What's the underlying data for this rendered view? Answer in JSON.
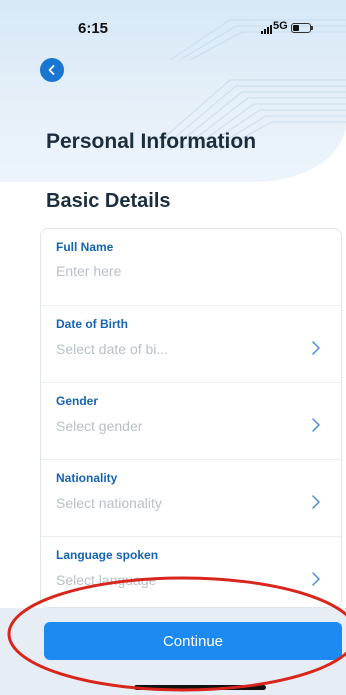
{
  "status_bar": {
    "time": "6:15",
    "network": "5G"
  },
  "header": {
    "title": "Personal Information"
  },
  "section": {
    "title": "Basic Details"
  },
  "fields": [
    {
      "label": "Full Name",
      "placeholder": "Enter here"
    },
    {
      "label": "Date of Birth",
      "value": "Select date of bi..."
    },
    {
      "label": "Gender",
      "value": "Select gender"
    },
    {
      "label": "Nationality",
      "value": "Select nationality"
    },
    {
      "label": "Language spoken",
      "value": "Select language"
    }
  ],
  "footer": {
    "continue_label": "Continue"
  },
  "colors": {
    "primary": "#1d8af1",
    "label": "#1565b4",
    "annotation": "#d9261c"
  },
  "icons": [
    "back-arrow-icon",
    "chevron-right-icon",
    "signal-icon",
    "battery-icon"
  ]
}
